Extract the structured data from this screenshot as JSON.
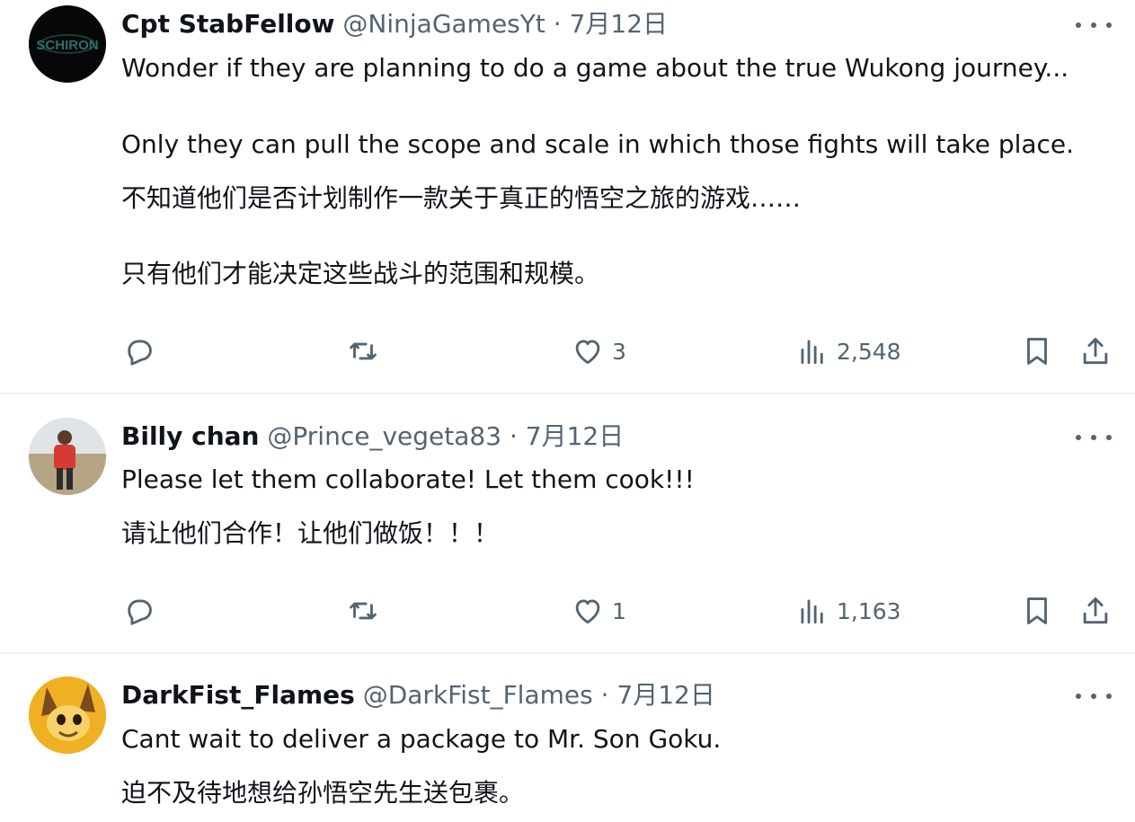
{
  "tweets": [
    {
      "name": "Cpt StabFellow",
      "handle": "@NinjaGamesYt",
      "separator": "·",
      "date": "7月12日",
      "avatar_text": "SCHIRON",
      "lines": [
        "Wonder if they are planning to do a game about the true Wukong journey...",
        "Only they can pull the scope and scale in which those fights will take place.",
        "不知道他们是否计划制作一款关于真正的悟空之旅的游戏……",
        "只有他们才能决定这些战斗的范围和规模。"
      ],
      "likes": "3",
      "views": "2,548"
    },
    {
      "name": "Billy chan",
      "handle": "@Prince_vegeta83",
      "separator": "·",
      "date": "7月12日",
      "lines": [
        "Please let them collaborate! Let them cook!!!",
        "请让他们合作！让他们做饭！！！"
      ],
      "likes": "1",
      "views": "1,163"
    },
    {
      "name": "DarkFist_Flames",
      "handle": "@DarkFist_Flames",
      "separator": "·",
      "date": "7月12日",
      "lines": [
        "Cant wait to deliver a package to Mr. Son Goku.",
        "迫不及待地想给孙悟空先生送包裹。"
      ]
    }
  ],
  "icons": {
    "reply": "reply-icon",
    "retweet": "retweet-icon",
    "like": "heart-icon",
    "views": "views-icon",
    "bookmark": "bookmark-icon",
    "share": "share-icon",
    "more": "more-icon"
  },
  "colors": {
    "text": "#0f1419",
    "secondary": "#536471",
    "divider": "#eff3f4"
  }
}
